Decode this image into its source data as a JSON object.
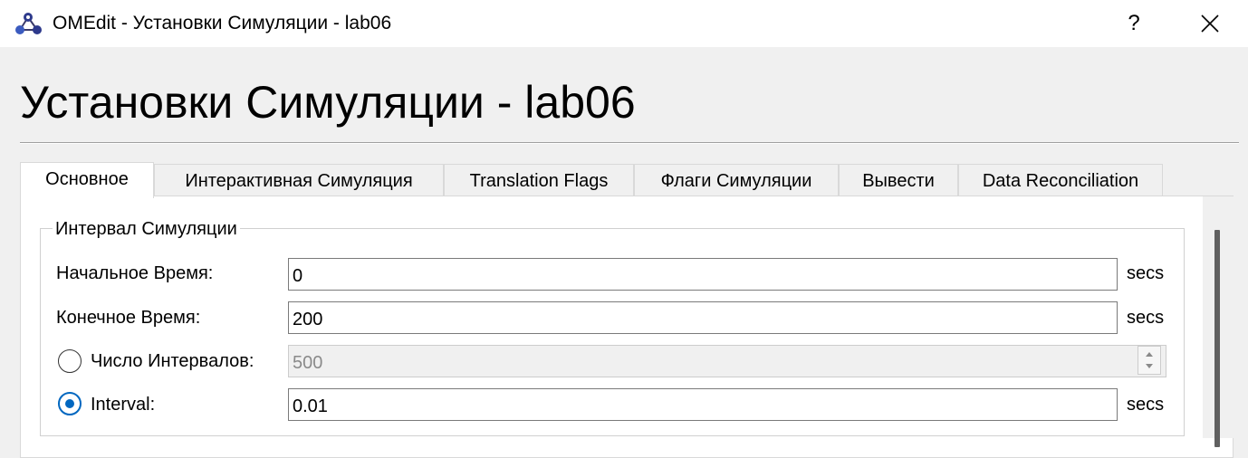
{
  "window": {
    "title": "OMEdit - Установки Симуляции - lab06",
    "help_label": "?",
    "app_icon": "omedit-logo-icon",
    "close_icon": "close-icon"
  },
  "page": {
    "title": "Установки Симуляции - lab06"
  },
  "tabs": [
    {
      "label": "Основное",
      "active": true
    },
    {
      "label": "Интерактивная Симуляция",
      "active": false
    },
    {
      "label": "Translation Flags",
      "active": false
    },
    {
      "label": "Флаги Симуляции",
      "active": false
    },
    {
      "label": "Вывести",
      "active": false
    },
    {
      "label": "Data Reconciliation",
      "active": false
    }
  ],
  "interval_group": {
    "legend": "Интервал Симуляции",
    "start_time": {
      "label": "Начальное Время:",
      "value": "0",
      "unit": "secs"
    },
    "stop_time": {
      "label": "Конечное Время:",
      "value": "200",
      "unit": "secs"
    },
    "number_of_intervals": {
      "label": "Число Интервалов:",
      "value": "500",
      "selected": false,
      "enabled": false
    },
    "interval": {
      "label": "Interval:",
      "value": "0.01",
      "unit": "secs",
      "selected": true
    }
  },
  "colors": {
    "accent": "#0067c0",
    "window_bg": "#f0f0f0",
    "panel_bg": "#ffffff"
  }
}
